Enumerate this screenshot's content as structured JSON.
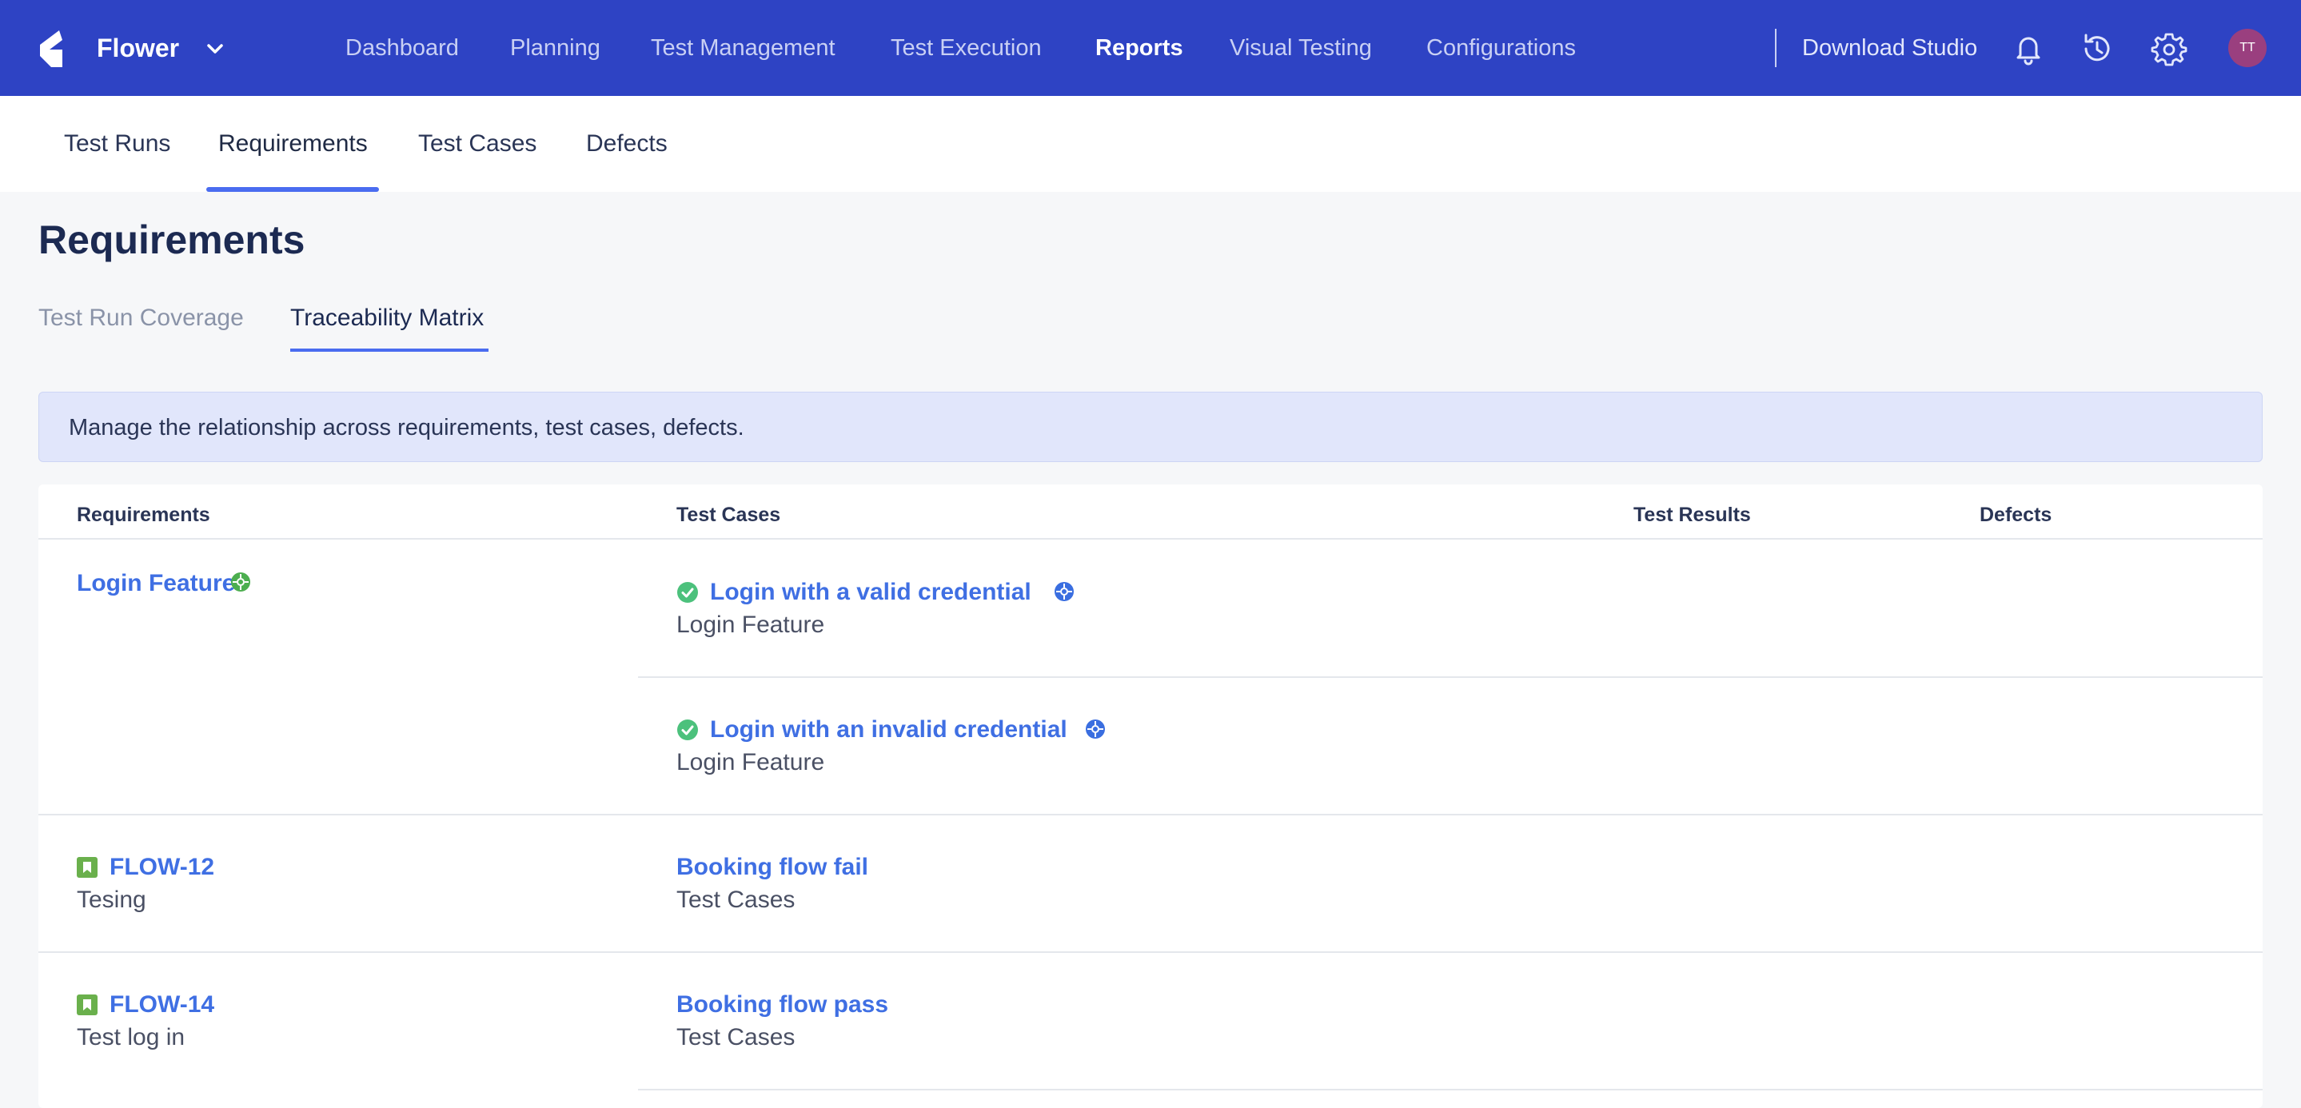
{
  "topbar": {
    "project": "Flower",
    "nav": [
      "Dashboard",
      "Planning",
      "Test Management",
      "Test Execution",
      "Reports",
      "Visual Testing",
      "Configurations"
    ],
    "active_nav": "Reports",
    "download": "Download Studio",
    "avatar": "TT",
    "icons": [
      "bell-icon",
      "history-icon",
      "gear-icon"
    ]
  },
  "subnav": {
    "items": [
      "Test Runs",
      "Requirements",
      "Test Cases",
      "Defects"
    ],
    "active": "Requirements"
  },
  "page": {
    "title": "Requirements",
    "tabs": [
      "Test Run Coverage",
      "Traceability Matrix"
    ],
    "active_tab": "Traceability Matrix",
    "info": "Manage the relationship across requirements, test cases, defects."
  },
  "table": {
    "headers": [
      "Requirements",
      "Test Cases",
      "Test Results",
      "Defects"
    ],
    "rows": [
      {
        "requirement": "Login Feature",
        "requirement_sub": "",
        "requirement_icon": "integration-icon",
        "cases": [
          {
            "name": "Login with a valid credential",
            "sub": "Login Feature",
            "status_icon": "check-circle-icon",
            "tag_icon": "integration-icon"
          },
          {
            "name": "Login with an invalid credential",
            "sub": "Login Feature",
            "status_icon": "check-circle-icon",
            "tag_icon": "integration-icon"
          }
        ]
      },
      {
        "requirement": "FLOW-12",
        "requirement_sub": "Tesing",
        "requirement_icon": "story-bookmark-icon",
        "cases": [
          {
            "name": "Booking flow fail",
            "sub": "Test Cases"
          }
        ]
      },
      {
        "requirement": "FLOW-14",
        "requirement_sub": "Test log in",
        "requirement_icon": "story-bookmark-icon",
        "cases": [
          {
            "name": "Booking flow pass",
            "sub": "Test Cases"
          }
        ]
      }
    ]
  },
  "colors": {
    "topbar": "#2e43c4",
    "accent": "#4a6cf0",
    "link": "#3f6fe3",
    "success": "#4cc17c",
    "story": "#6ab04c"
  }
}
